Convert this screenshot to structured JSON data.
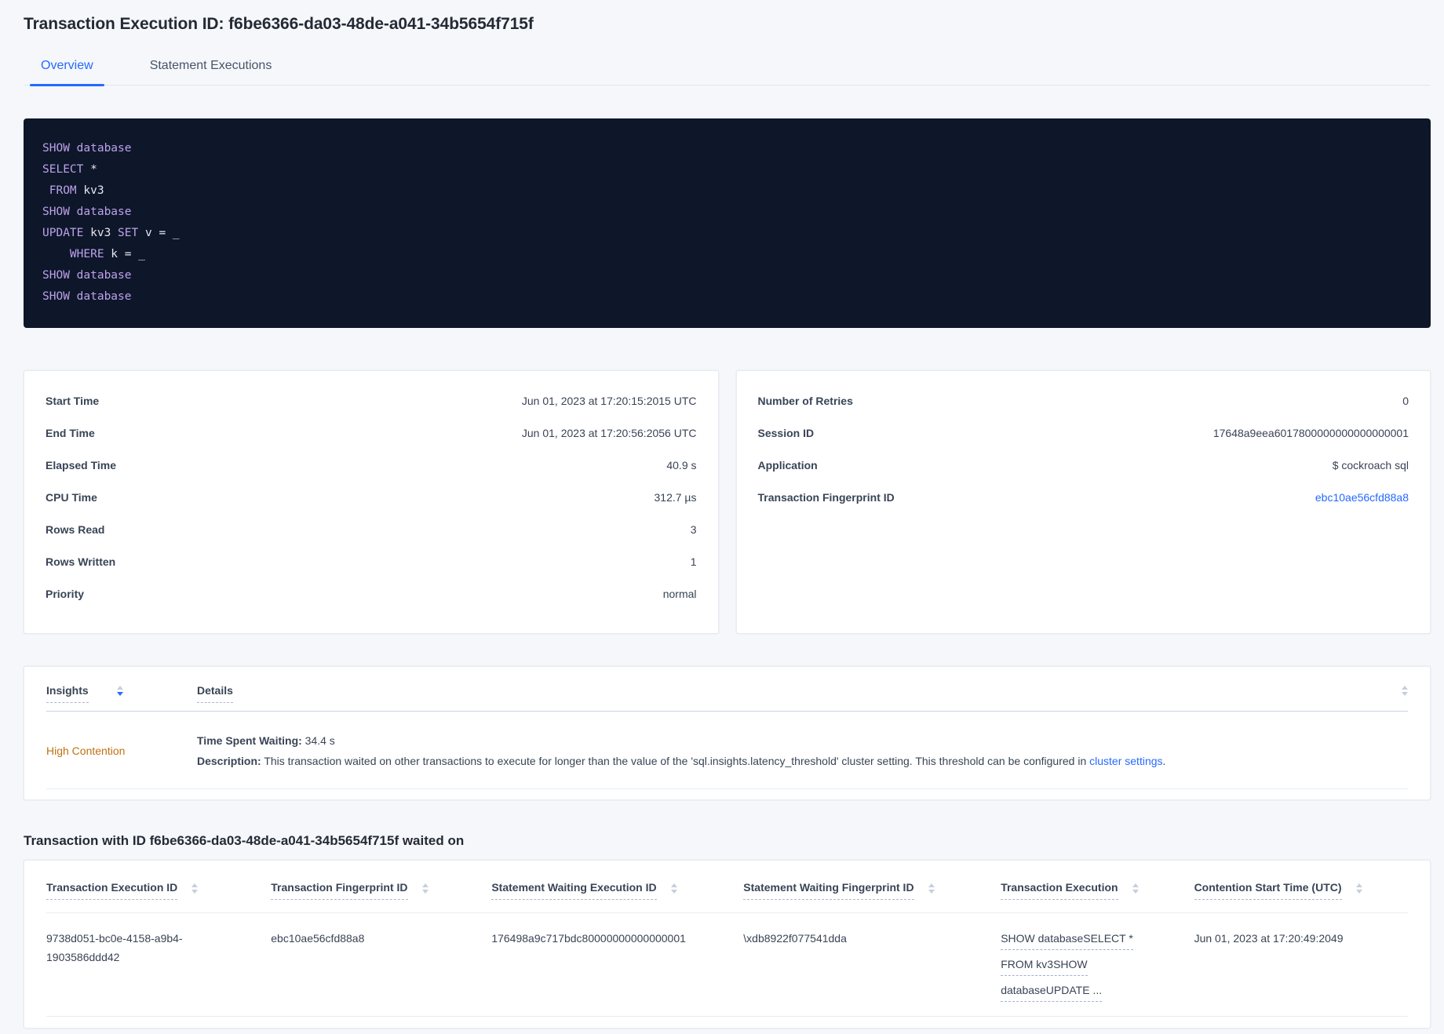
{
  "header": {
    "title": "Transaction Execution ID: f6be6366-da03-48de-a041-34b5654f715f",
    "tabs": {
      "overview": "Overview",
      "statement_executions": "Statement Executions"
    }
  },
  "colors": {
    "accent_blue": "#2669ff",
    "insight_warning_orange": "#c1700f",
    "sql_background": "#0d1729",
    "sql_keyword_purple": "#bea1ec"
  },
  "sql": {
    "lines": [
      [
        {
          "type": "kw",
          "text": "SHOW"
        },
        {
          "type": "pl",
          "text": " "
        },
        {
          "type": "kw",
          "text": "database"
        }
      ],
      [
        {
          "type": "kw",
          "text": "SELECT"
        },
        {
          "type": "pl",
          "text": " *"
        }
      ],
      [
        {
          "type": "pl",
          "text": " "
        },
        {
          "type": "kw",
          "text": "FROM"
        },
        {
          "type": "pl",
          "text": " kv3"
        }
      ],
      [
        {
          "type": "kw",
          "text": "SHOW"
        },
        {
          "type": "pl",
          "text": " "
        },
        {
          "type": "kw",
          "text": "database"
        }
      ],
      [
        {
          "type": "kw",
          "text": "UPDATE"
        },
        {
          "type": "pl",
          "text": " kv3 "
        },
        {
          "type": "kw",
          "text": "SET"
        },
        {
          "type": "pl",
          "text": " v = _"
        }
      ],
      [
        {
          "type": "pl",
          "text": "    "
        },
        {
          "type": "kw",
          "text": "WHERE"
        },
        {
          "type": "pl",
          "text": " k = _"
        }
      ],
      [
        {
          "type": "kw",
          "text": "SHOW"
        },
        {
          "type": "pl",
          "text": " "
        },
        {
          "type": "kw",
          "text": "database"
        }
      ],
      [
        {
          "type": "kw",
          "text": "SHOW"
        },
        {
          "type": "pl",
          "text": " "
        },
        {
          "type": "kw",
          "text": "database"
        }
      ]
    ]
  },
  "summary_left": {
    "rows": [
      {
        "label": "Start Time",
        "value": "Jun 01, 2023 at 17:20:15:2015 UTC"
      },
      {
        "label": "End Time",
        "value": "Jun 01, 2023 at 17:20:56:2056 UTC"
      },
      {
        "label": "Elapsed Time",
        "value": "40.9 s"
      },
      {
        "label": "CPU Time",
        "value": "312.7 µs"
      },
      {
        "label": "Rows Read",
        "value": "3"
      },
      {
        "label": "Rows Written",
        "value": "1"
      },
      {
        "label": "Priority",
        "value": "normal"
      }
    ]
  },
  "summary_right": {
    "rows": [
      {
        "label": "Number of Retries",
        "value": "0"
      },
      {
        "label": "Session ID",
        "value": "17648a9eea6017800000000000000001"
      },
      {
        "label": "Application",
        "value": "$ cockroach sql"
      },
      {
        "label": "Transaction Fingerprint ID",
        "value": "ebc10ae56cfd88a8"
      }
    ]
  },
  "insights": {
    "col_insights": "Insights",
    "col_details": "Details",
    "row": {
      "insight": "High Contention",
      "waiting_label": "Time Spent Waiting:",
      "waiting_value": " 34.4 s",
      "desc_label": "Description:",
      "desc_text": " This transaction waited on other transactions to execute for longer than the value of the 'sql.insights.latency_threshold' cluster setting. This threshold can be configured in ",
      "desc_link": "cluster settings",
      "desc_suffix": "."
    }
  },
  "waited_on": {
    "heading": "Transaction with ID f6be6366-da03-48de-a041-34b5654f715f waited on",
    "columns": [
      "Transaction Execution ID",
      "Transaction Fingerprint ID",
      "Statement Waiting Execution ID",
      "Statement Waiting Fingerprint ID",
      "Transaction Execution",
      "Contention Start Time (UTC)"
    ],
    "row": {
      "transaction_execution_id": "9738d051-bc0e-4158-a9b4-1903586ddd42",
      "transaction_fingerprint_id": "ebc10ae56cfd88a8",
      "statement_waiting_execution_id": "176498a9c717bdc80000000000000001",
      "statement_waiting_fingerprint_id": "\\xdb8922f077541dda",
      "transaction_execution_lines": [
        "SHOW databaseSELECT *",
        "FROM kv3SHOW",
        "databaseUPDATE ..."
      ],
      "contention_start_time": "Jun 01, 2023 at 17:20:49:2049"
    }
  }
}
